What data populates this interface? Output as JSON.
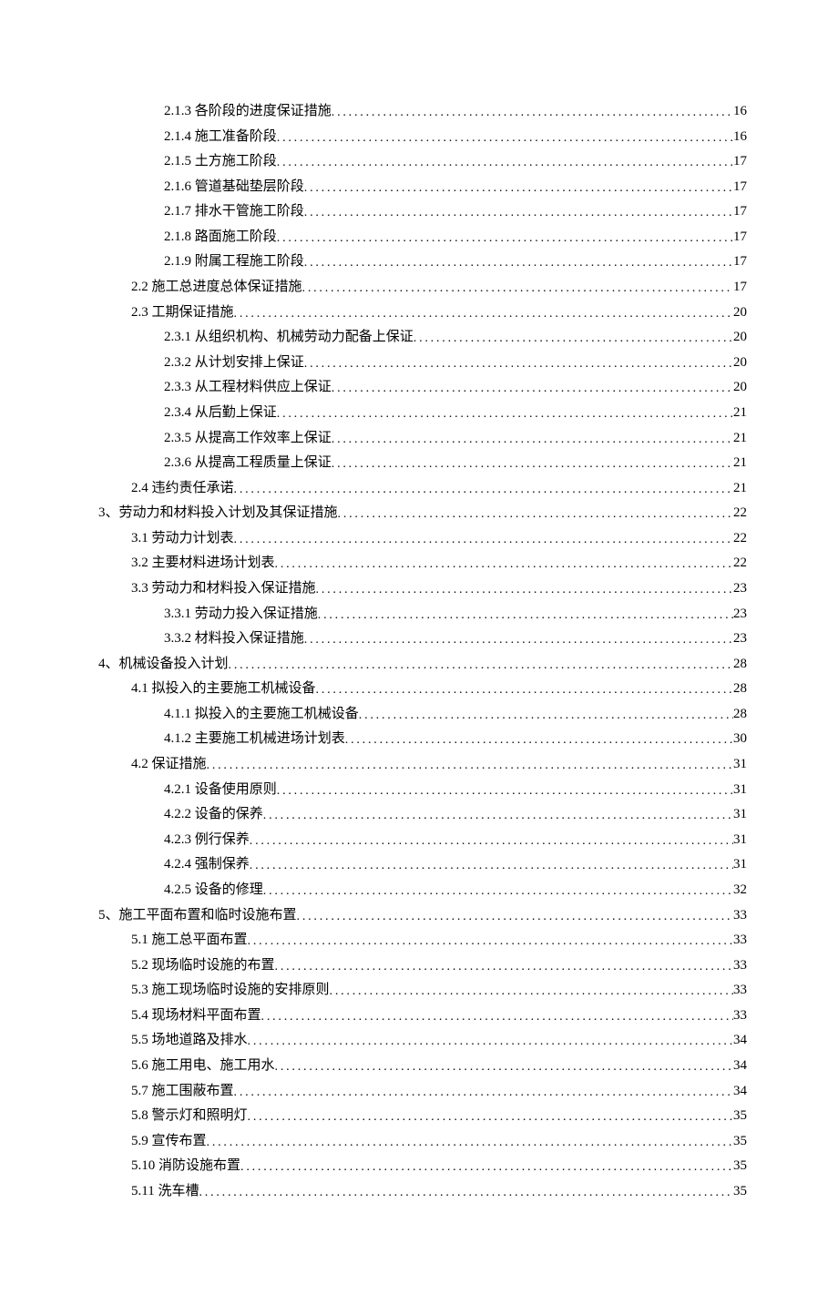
{
  "toc": [
    {
      "level": 2,
      "label": "2.1.3  各阶段的进度保证措施",
      "page": "16"
    },
    {
      "level": 2,
      "label": "2.1.4 施工准备阶段",
      "page": "16"
    },
    {
      "level": 2,
      "label": "2.1.5  土方施工阶段",
      "page": "17"
    },
    {
      "level": 2,
      "label": "2.1.6  管道基础垫层阶段",
      "page": "17"
    },
    {
      "level": 2,
      "label": "2.1.7  排水干管施工阶段",
      "page": "17"
    },
    {
      "level": 2,
      "label": "2.1.8  路面施工阶段",
      "page": "17"
    },
    {
      "level": 2,
      "label": "2.1.9 附属工程施工阶段",
      "page": "17"
    },
    {
      "level": 1,
      "label": "2.2 施工总进度总体保证措施",
      "page": "17"
    },
    {
      "level": 1,
      "label": "2.3 工期保证措施",
      "page": "20"
    },
    {
      "level": 2,
      "label": "2.3.1  从组织机构、机械劳动力配备上保证",
      "page": "20"
    },
    {
      "level": 2,
      "label": "2.3.2  从计划安排上保证",
      "page": "20"
    },
    {
      "level": 2,
      "label": "2.3.3  从工程材料供应上保证",
      "page": "20"
    },
    {
      "level": 2,
      "label": "2.3.4  从后勤上保证",
      "page": "21"
    },
    {
      "level": 2,
      "label": "2.3.5  从提高工作效率上保证",
      "page": "21"
    },
    {
      "level": 2,
      "label": "2.3.6  从提高工程质量上保证",
      "page": "21"
    },
    {
      "level": 1,
      "label": "2.4  违约责任承诺",
      "page": "21"
    },
    {
      "level": 0,
      "label": "3、劳动力和材料投入计划及其保证措施",
      "page": "22"
    },
    {
      "level": 1,
      "label": "3.1 劳动力计划表",
      "page": "22"
    },
    {
      "level": 1,
      "label": "3.2 主要材料进场计划表",
      "page": "22"
    },
    {
      "level": 1,
      "label": "3.3  劳动力和材料投入保证措施",
      "page": "23"
    },
    {
      "level": 2,
      "label": "3.3.1 劳动力投入保证措施",
      "page": "23"
    },
    {
      "level": 2,
      "label": "3.3.2  材料投入保证措施",
      "page": "23"
    },
    {
      "level": 0,
      "label": "4、机械设备投入计划",
      "page": "28"
    },
    {
      "level": 1,
      "label": "4.1 拟投入的主要施工机械设备",
      "page": "28"
    },
    {
      "level": 2,
      "label": "4.1.1 拟投入的主要施工机械设备",
      "page": "28"
    },
    {
      "level": 2,
      "label": "4.1.2 主要施工机械进场计划表",
      "page": "30"
    },
    {
      "level": 1,
      "label": "4.2 保证措施",
      "page": "31"
    },
    {
      "level": 2,
      "label": "4.2.1  设备使用原则",
      "page": "31"
    },
    {
      "level": 2,
      "label": "4.2.2  设备的保养",
      "page": "31"
    },
    {
      "level": 2,
      "label": "4.2.3  例行保养",
      "page": "31"
    },
    {
      "level": 2,
      "label": "4.2.4  强制保养",
      "page": "31"
    },
    {
      "level": 2,
      "label": "4.2.5  设备的修理",
      "page": "32"
    },
    {
      "level": 0,
      "label": "5、施工平面布置和临时设施布置",
      "page": "33"
    },
    {
      "level": 1,
      "label": "5.1  施工总平面布置",
      "page": "33"
    },
    {
      "level": 1,
      "label": "5.2  现场临时设施的布置",
      "page": "33"
    },
    {
      "level": 1,
      "label": "5.3  施工现场临时设施的安排原则",
      "page": "33"
    },
    {
      "level": 1,
      "label": "5.4  现场材料平面布置",
      "page": "33"
    },
    {
      "level": 1,
      "label": "5.5  场地道路及排水",
      "page": "34"
    },
    {
      "level": 1,
      "label": "5.6  施工用电、施工用水",
      "page": "34"
    },
    {
      "level": 1,
      "label": "5.7  施工围蔽布置",
      "page": "34"
    },
    {
      "level": 1,
      "label": "5.8  警示灯和照明灯",
      "page": "35"
    },
    {
      "level": 1,
      "label": "5.9  宣传布置",
      "page": "35"
    },
    {
      "level": 1,
      "label": "5.10  消防设施布置",
      "page": "35"
    },
    {
      "level": 1,
      "label": "5.11  洗车槽",
      "page": "35"
    }
  ]
}
